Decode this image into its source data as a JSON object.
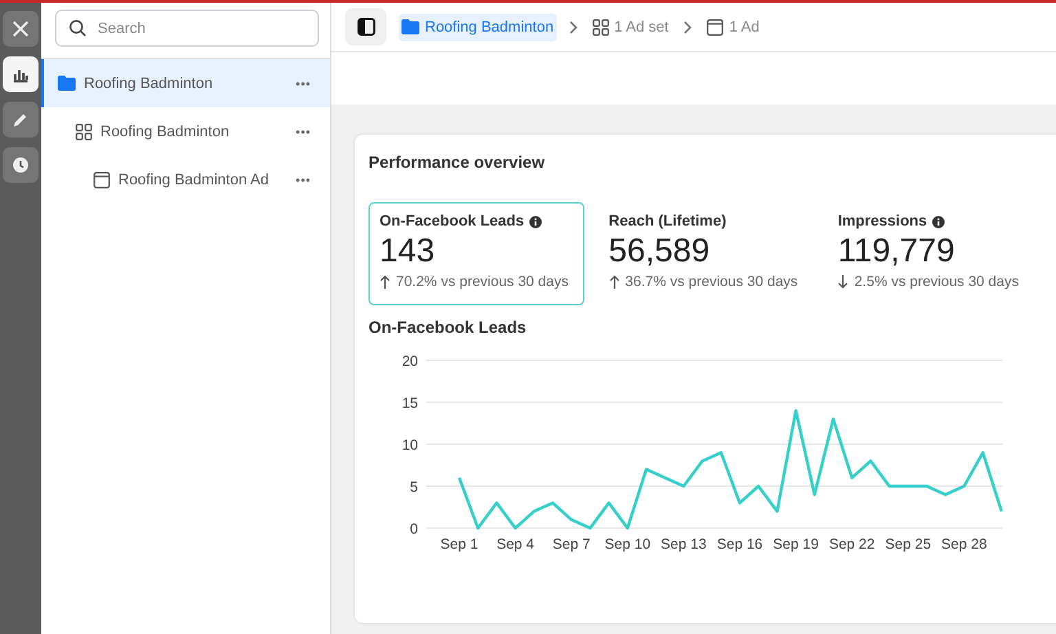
{
  "rail": [
    {
      "kind": "close",
      "selected": false
    },
    {
      "kind": "chart",
      "selected": true
    },
    {
      "kind": "pencil",
      "selected": false
    },
    {
      "kind": "clock",
      "selected": false
    }
  ],
  "sidebar": {
    "search": {
      "placeholder": "Search"
    },
    "tree": [
      {
        "kind": "campaign",
        "label": "Roofing Badminton",
        "selected": true,
        "more": "•••",
        "children": [
          {
            "kind": "adset",
            "label": "Roofing Badminton",
            "selected": false,
            "more": "•••",
            "children": [
              {
                "kind": "ad",
                "label": "Roofing Badminton Ad",
                "selected": false,
                "more": "•••"
              }
            ]
          }
        ]
      }
    ]
  },
  "breadcrumbs": [
    {
      "kind": "campaign",
      "label": "Roofing Badminton",
      "selected": true
    },
    {
      "kind": "adset",
      "label": "1 Ad set",
      "selected": false
    },
    {
      "kind": "ad",
      "label": "1 Ad",
      "selected": false
    }
  ],
  "overview": {
    "title": "Performance overview",
    "metrics": [
      {
        "label": "On-Facebook Leads",
        "info": true,
        "value": "143",
        "kind": "up",
        "change": "70.2% vs previous 30 days",
        "selected": true
      },
      {
        "label": "Reach (Lifetime)",
        "info": false,
        "value": "56,589",
        "kind": "up",
        "change": "36.7% vs previous 30 days",
        "selected": false
      },
      {
        "label": "Impressions",
        "info": true,
        "value": "119,779",
        "kind": "down",
        "change": "2.5% vs previous 30 days",
        "selected": false
      }
    ],
    "chart_data": {
      "type": "line",
      "title": "On-Facebook Leads",
      "categories": [
        "Sep 1",
        null,
        null,
        "Sep 4",
        null,
        null,
        "Sep 7",
        null,
        null,
        "Sep 10",
        null,
        null,
        "Sep 13",
        null,
        null,
        "Sep 16",
        null,
        null,
        "Sep 19",
        null,
        null,
        "Sep 22",
        null,
        null,
        "Sep 25",
        null,
        null,
        "Sep 28",
        null,
        null
      ],
      "series": [
        {
          "color": "#36cfc9",
          "values": [
            6,
            0,
            3,
            0,
            2,
            3,
            1,
            0,
            3,
            0,
            7,
            6,
            5,
            8,
            9,
            3,
            5,
            2,
            14,
            4,
            13,
            6,
            8,
            5,
            5,
            5,
            4,
            5,
            9,
            2
          ]
        }
      ],
      "ylim": [
        0,
        20
      ],
      "grid": true,
      "yticks": [
        0,
        5,
        10,
        15,
        20
      ]
    }
  }
}
